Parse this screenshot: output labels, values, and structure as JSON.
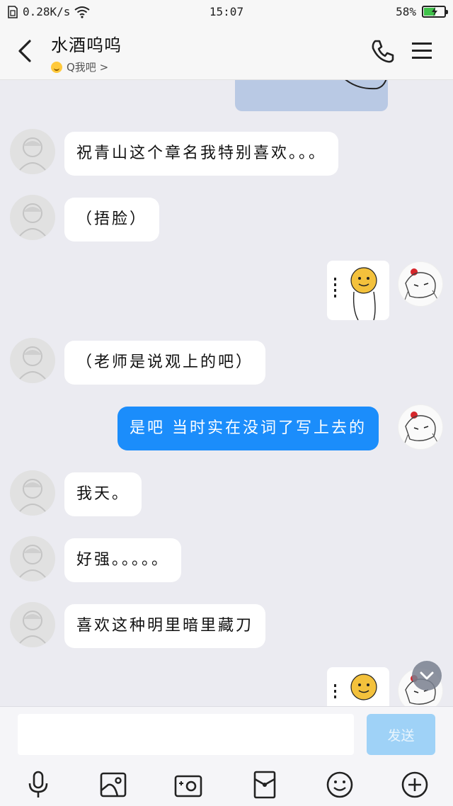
{
  "status_bar": {
    "network_speed": "0.28K/s",
    "time": "15:07",
    "battery_text": "58%",
    "battery_level": 0.58
  },
  "header": {
    "title": "水酒呜呜",
    "subtitle": "Q我吧 >"
  },
  "messages": [
    {
      "side": "in",
      "type": "text",
      "text": "祝青山这个章名我特别喜欢。。。"
    },
    {
      "side": "in",
      "type": "text",
      "text": "（捂脸）"
    },
    {
      "side": "out",
      "type": "sticker"
    },
    {
      "side": "in",
      "type": "text",
      "text": "（老师是说观上的吧）"
    },
    {
      "side": "out",
      "type": "text",
      "text": "是吧 当时实在没词了写上去的"
    },
    {
      "side": "in",
      "type": "text",
      "text": "我天。"
    },
    {
      "side": "in",
      "type": "text",
      "text": "好强。。。。。"
    },
    {
      "side": "in",
      "type": "text",
      "text": "喜欢这种明里暗里藏刀"
    },
    {
      "side": "out",
      "type": "sticker"
    }
  ],
  "input": {
    "value": "",
    "placeholder": ""
  },
  "send_label": "发送",
  "toolbar_icons": [
    "microphone-icon",
    "image-icon",
    "camera-icon",
    "red-envelope-icon",
    "emoji-icon",
    "plus-icon"
  ],
  "colors": {
    "outgoing_bubble": "#1b8dfb",
    "incoming_bubble": "#ffffff",
    "chat_background": "#ebebf1",
    "send_button": "#9fd2f7"
  }
}
